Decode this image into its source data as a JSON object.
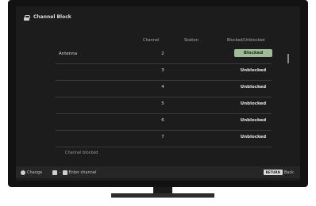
{
  "header": {
    "title": "Channel Block",
    "icon": "lock-icon"
  },
  "columns": {
    "channel": "Channel",
    "station": "Station",
    "status": "Blocked/Unblocked"
  },
  "rows": [
    {
      "antenna": "Antenna",
      "channel": "2",
      "status": "Blocked",
      "blocked": true
    },
    {
      "antenna": "",
      "channel": "3",
      "status": "Unblocked",
      "blocked": false
    },
    {
      "antenna": "",
      "channel": "4",
      "status": "Unblocked",
      "blocked": false
    },
    {
      "antenna": "",
      "channel": "5",
      "status": "Unblocked",
      "blocked": false
    },
    {
      "antenna": "",
      "channel": "6",
      "status": "Unblocked",
      "blocked": false
    },
    {
      "antenna": "",
      "channel": "7",
      "status": "Unblocked",
      "blocked": false
    }
  ],
  "footer_note": "Channel blocked",
  "bottom_bar": {
    "change_label": "Change",
    "enter_channel_label": "Enter channel",
    "back_key": "RETURN",
    "back_label": "Back"
  },
  "colors": {
    "blocked_badge": "#9fbb98",
    "background": "#1c1c1c"
  }
}
